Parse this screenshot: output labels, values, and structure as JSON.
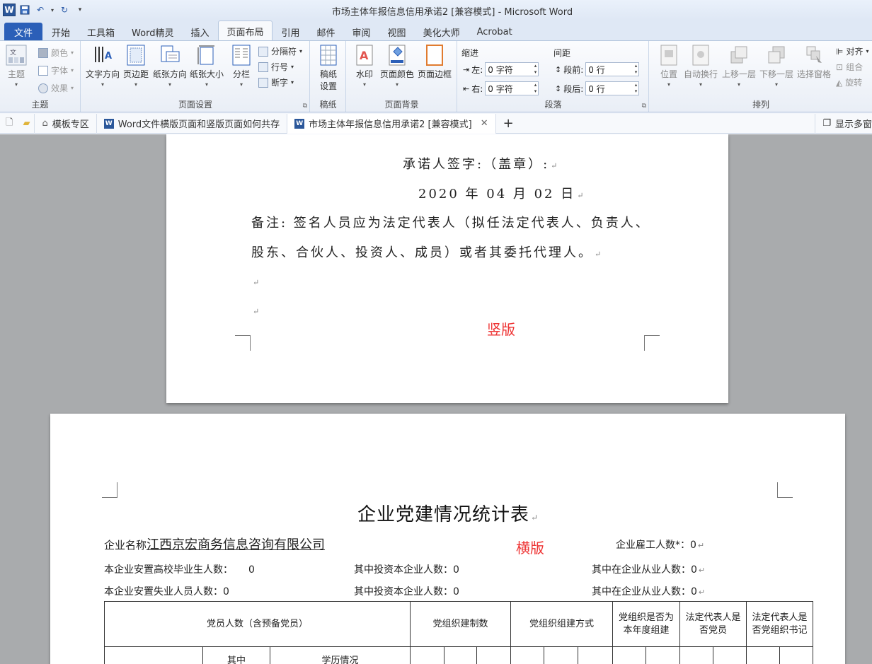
{
  "window": {
    "title": "市场主体年报信息信用承诺2 [兼容模式] - Microsoft Word"
  },
  "qat": {
    "logo": "W",
    "save_icon": "save-icon",
    "undo_icon": "undo-icon",
    "redo_icon": "redo-icon"
  },
  "tabs": [
    {
      "label": "文件"
    },
    {
      "label": "开始"
    },
    {
      "label": "工具箱"
    },
    {
      "label": "Word精灵"
    },
    {
      "label": "插入"
    },
    {
      "label": "页面布局"
    },
    {
      "label": "引用"
    },
    {
      "label": "邮件"
    },
    {
      "label": "审阅"
    },
    {
      "label": "视图"
    },
    {
      "label": "美化大师"
    },
    {
      "label": "Acrobat"
    }
  ],
  "ribbon": {
    "theme": {
      "label": "主题",
      "btn": "主题",
      "colors": "颜色",
      "fonts": "字体",
      "effects": "效果"
    },
    "page_setup": {
      "label": "页面设置",
      "text_dir": "文字方向",
      "margins": "页边距",
      "orientation": "纸张方向",
      "size": "纸张大小",
      "columns": "分栏",
      "breaks": "分隔符",
      "line_numbers": "行号",
      "hyphenation": "断字"
    },
    "manuscript": {
      "label": "稿纸",
      "btn1": "稿纸",
      "btn2": "设置"
    },
    "background": {
      "label": "页面背景",
      "watermark": "水印",
      "page_color": "页面颜色",
      "page_borders": "页面边框"
    },
    "paragraph": {
      "label": "段落",
      "indent": "缩进",
      "spacing": "间距",
      "left": "左:",
      "right": "右:",
      "before": "段前:",
      "after": "段后:",
      "left_val": "0 字符",
      "right_val": "0 字符",
      "before_val": "0 行",
      "after_val": "0 行"
    },
    "arrange": {
      "label": "排列",
      "position": "位置",
      "wrap": "自动换行",
      "forward": "上移一层",
      "backward": "下移一层",
      "pane": "选择窗格",
      "align": "对齐",
      "group": "组合",
      "rotate": "旋转"
    }
  },
  "doc_tabs": [
    {
      "label": "模板专区"
    },
    {
      "label": "Word文件横版页面和竖版页面如何共存"
    },
    {
      "label": "市场主体年报信息信用承诺2 [兼容模式]"
    }
  ],
  "doc_strip_right": "显示多窗",
  "page1": {
    "sign": "承诺人签字:（盖章）:",
    "date": "2020 年 04 月 02 日",
    "note1": "备注: 签名人员应为法定代表人（拟任法定代表人、负责人、",
    "note2": "股东、合伙人、投资人、成员）或者其委托代理人。",
    "mark": "↵",
    "label": "竖版"
  },
  "page2": {
    "title": "企业党建情况统计表",
    "company_prefix": "企业名称",
    "company_name": "江西京宏商务信息咨询有限公司",
    "label": "横版",
    "employees": "企业雇工人数*：0",
    "grad": "本企业安置高校毕业生人数：",
    "grad_val": "0",
    "invest1": "其中投资本企业人数：0",
    "work1": "其中在企业从业人数：0",
    "unemp": "本企业安置失业人员人数：0",
    "invest2": "其中投资本企业人数：0",
    "work2": "其中在企业从业人数：0",
    "table": {
      "h_members": "党员人数（含预备党员）",
      "h_system": "党组织建制数",
      "h_method": "党组织组建方式",
      "h_newyear": "党组织是否为本年度组建",
      "h_legal": "法定代表人是否党员",
      "h_secretary": "法定代表人是否党组织书记",
      "r2_among": "其中",
      "r2_edu": "学历情况"
    }
  }
}
